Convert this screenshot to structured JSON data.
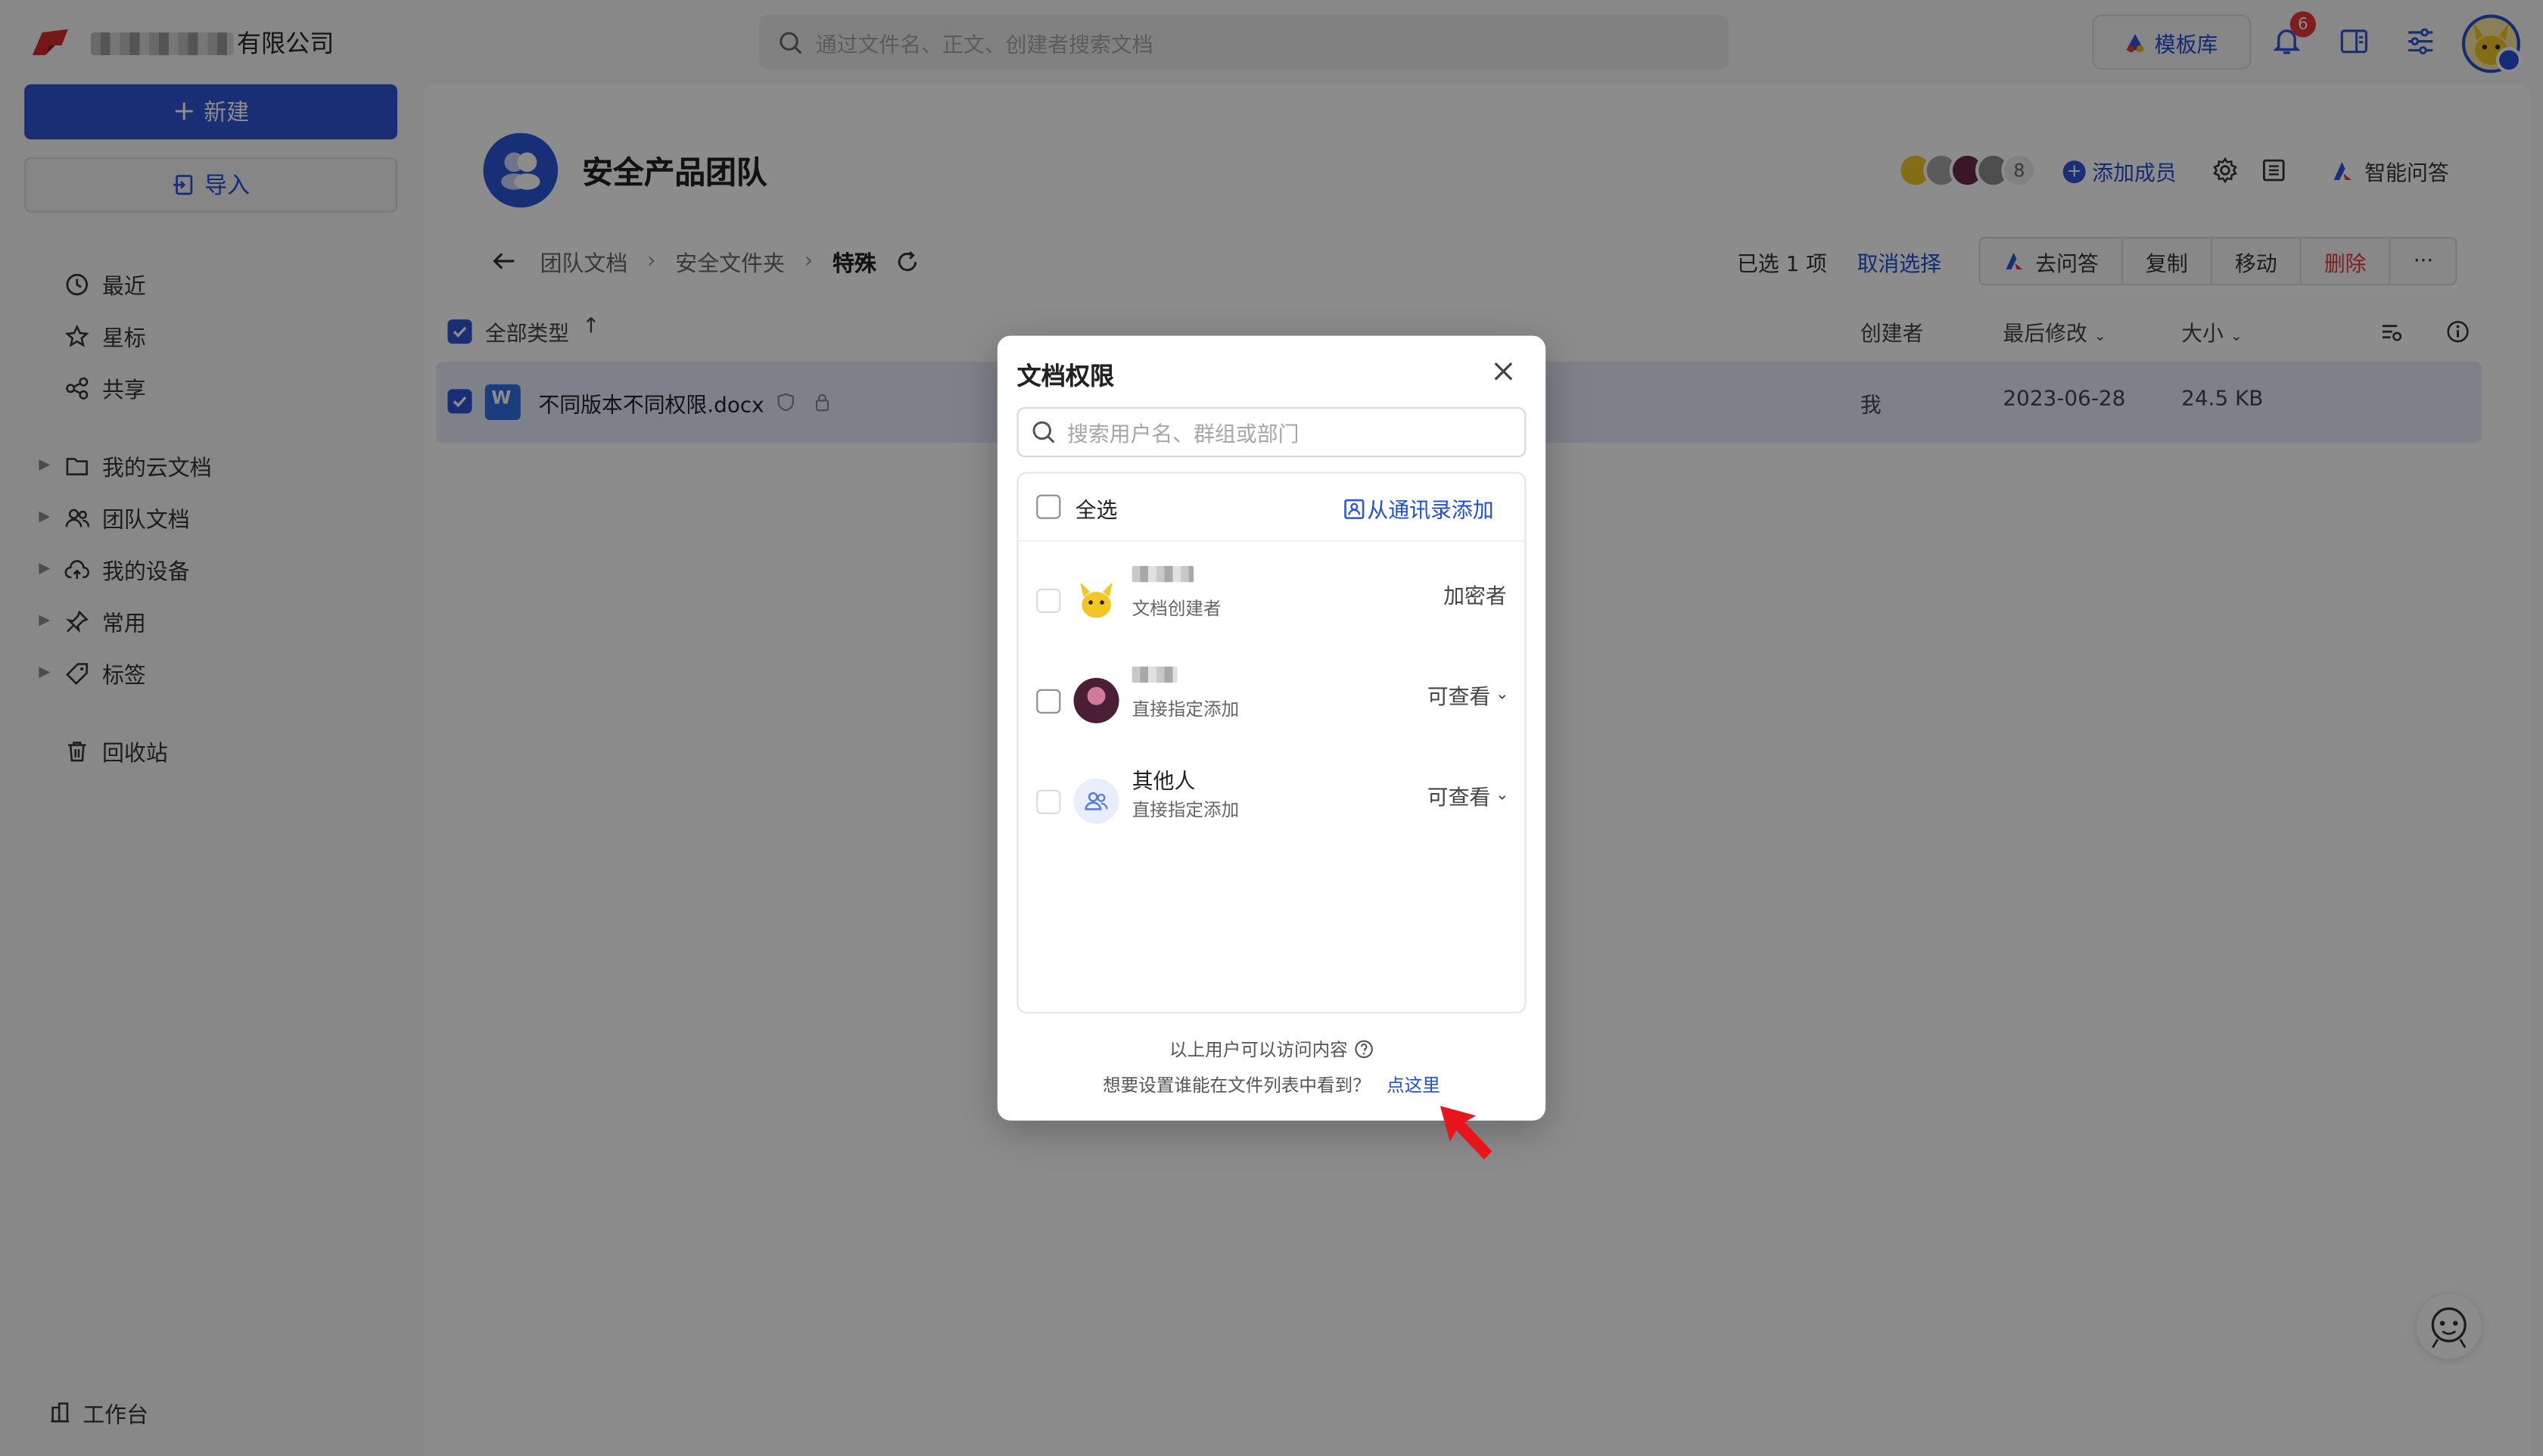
{
  "topbar": {
    "company_suffix": "有限公司",
    "search_placeholder": "通过文件名、正文、创建者搜索文档",
    "template_button": "模板库",
    "notification_count": "6"
  },
  "sidebar": {
    "new_button": "新建",
    "import_button": "导入",
    "nav_top": [
      "最近",
      "星标",
      "共享"
    ],
    "nav_groups": [
      "我的云文档",
      "团队文档",
      "我的设备",
      "常用",
      "标签"
    ],
    "trash": "回收站",
    "workbench": "工作台"
  },
  "team": {
    "name": "安全产品团队",
    "member_count": "8",
    "add_member": "添加成员",
    "ai_qa": "智能问答"
  },
  "breadcrumb": {
    "items": [
      "团队文档",
      "安全文件夹"
    ],
    "current": "特殊"
  },
  "selection": {
    "info": "已选 1 项",
    "cancel": "取消选择",
    "actions": [
      "去问答",
      "复制",
      "移动",
      "删除"
    ],
    "more": "···"
  },
  "table": {
    "type_header": "全部类型",
    "sort_arrow": "↑",
    "creator_header": "创建者",
    "modified_header": "最后修改",
    "size_header": "大小",
    "rows": [
      {
        "name": "不同版本不同权限.docx",
        "creator": "我",
        "modified": "2023-06-28",
        "size": "24.5 KB"
      }
    ]
  },
  "modal": {
    "title": "文档权限",
    "search_placeholder": "搜索用户名、群组或部门",
    "select_all": "全选",
    "add_from_contacts": "从通讯录添加",
    "members": [
      {
        "subtitle": "文档创建者",
        "role": "加密者"
      },
      {
        "subtitle": "直接指定添加",
        "role": "可查看"
      },
      {
        "name": "其他人",
        "subtitle": "直接指定添加",
        "role": "可查看"
      }
    ],
    "footer_note": "以上用户可以访问内容",
    "footer_question": "想要设置谁能在文件列表中看到？",
    "footer_link": "点这里"
  },
  "colors": {
    "primary": "#2e55d6",
    "danger": "#e53935",
    "annotation_arrow": "#e8151b"
  }
}
